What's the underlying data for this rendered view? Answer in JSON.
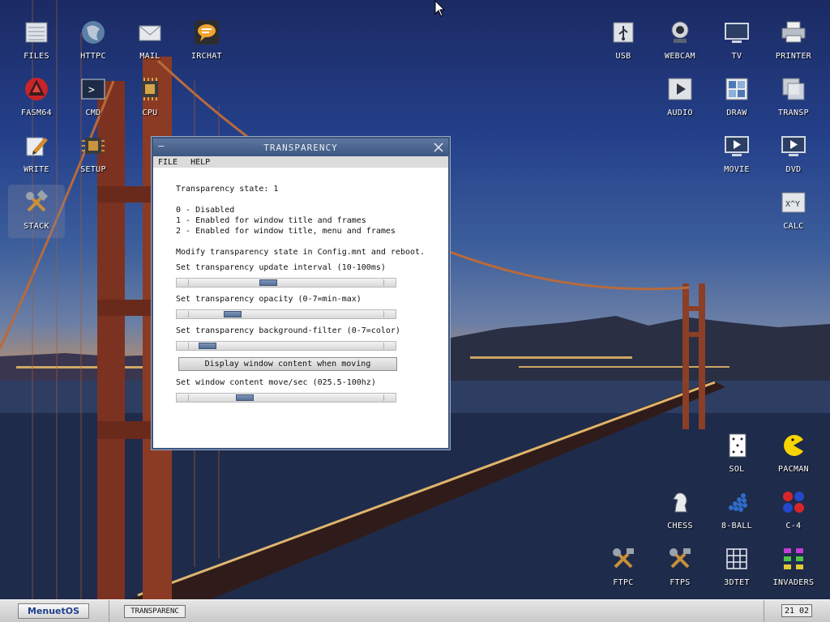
{
  "desktop": {
    "left_icons": [
      {
        "label": "FILES",
        "icon": "files-icon"
      },
      {
        "label": "HTTPC",
        "icon": "globe-icon"
      },
      {
        "label": "MAIL",
        "icon": "mail-icon"
      },
      {
        "label": "IRCHAT",
        "icon": "chat-icon"
      },
      {
        "label": "FASM64",
        "icon": "fasm-icon"
      },
      {
        "label": "CMD",
        "icon": "terminal-icon"
      },
      {
        "label": "CPU",
        "icon": "cpu-icon"
      },
      {
        "label": "WRITE",
        "icon": "write-icon"
      },
      {
        "label": "SETUP",
        "icon": "setup-icon"
      },
      {
        "label": "STACK",
        "icon": "tools-icon"
      }
    ],
    "right_icons": [
      {
        "label": "USB",
        "icon": "usb-icon"
      },
      {
        "label": "WEBCAM",
        "icon": "webcam-icon"
      },
      {
        "label": "TV",
        "icon": "tv-icon"
      },
      {
        "label": "PRINTER",
        "icon": "printer-icon"
      },
      {
        "label": "AUDIO",
        "icon": "audio-icon"
      },
      {
        "label": "DRAW",
        "icon": "draw-icon"
      },
      {
        "label": "TRANSP",
        "icon": "transparency-icon"
      },
      {
        "label": "MOVIE",
        "icon": "movie-icon"
      },
      {
        "label": "DVD",
        "icon": "dvd-icon"
      },
      {
        "label": "CALC",
        "icon": "calculator-icon"
      },
      {
        "label": "SOL",
        "icon": "solitaire-icon"
      },
      {
        "label": "PACMAN",
        "icon": "pacman-icon"
      },
      {
        "label": "CHESS",
        "icon": "chess-icon"
      },
      {
        "label": "8-BALL",
        "icon": "eight-ball-icon"
      },
      {
        "label": "C-4",
        "icon": "connect-four-icon"
      },
      {
        "label": "FTPC",
        "icon": "ftpc-icon"
      },
      {
        "label": "FTPS",
        "icon": "ftps-icon"
      },
      {
        "label": "3DTET",
        "icon": "tetris-icon"
      },
      {
        "label": "INVADERS",
        "icon": "invaders-icon"
      }
    ]
  },
  "window": {
    "title": "TRANSPARENCY",
    "menu": [
      "FILE",
      "HELP"
    ],
    "state_line": "Transparency state: 1",
    "options": [
      "0 - Disabled",
      "1 - Enabled for window title and frames",
      "2 - Enabled for window title, menu and frames"
    ],
    "note": "Modify transparency state in Config.mnt and reboot.",
    "sliders": [
      {
        "label": "Set transparency update interval (10-100ms)",
        "value_fraction": 0.4
      },
      {
        "label": "Set transparency opacity (0-7=min-max)",
        "value_fraction": 0.2
      },
      {
        "label": "Set transparency background-filter (0-7=color)",
        "value_fraction": 0.06
      }
    ],
    "button_label": "Display window content when moving",
    "move_slider": {
      "label": "Set window content move/sec (025.5-100hz)",
      "value_fraction": 0.27
    }
  },
  "taskbar": {
    "start_label": "MenuetOS",
    "task_label": "TRANSPARENC",
    "clock": "21 02"
  },
  "colors": {
    "accent": "#3d5680",
    "thumb": "#566f97",
    "start_text": "#1d3f8f"
  }
}
